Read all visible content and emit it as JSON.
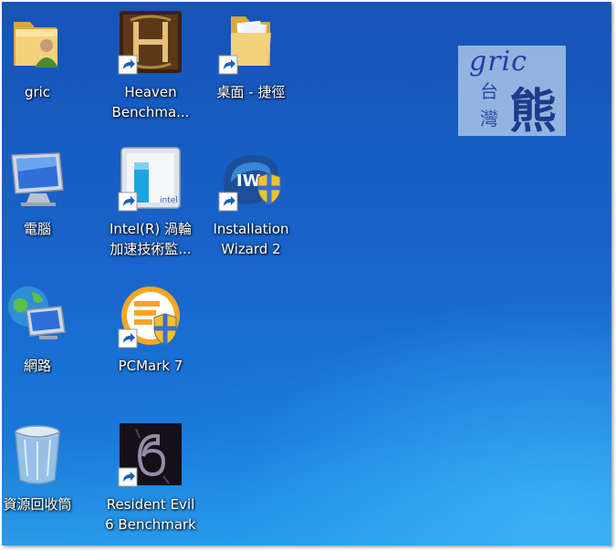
{
  "desktop_icons": [
    {
      "id": "gric",
      "label": "gric",
      "icon": "user-folder-icon"
    },
    {
      "id": "heaven",
      "label": "Heaven\nBenchma...",
      "icon": "heaven-benchmark-icon"
    },
    {
      "id": "desktop-shortcut",
      "label": "桌面 - 捷徑",
      "icon": "folder-icon"
    },
    {
      "id": "computer",
      "label": "電腦",
      "icon": "computer-icon"
    },
    {
      "id": "intel",
      "label": "Intel(R) 渦輪\n加速技術監...",
      "icon": "intel-turbo-icon"
    },
    {
      "id": "installation",
      "label": "Installation\nWizard 2",
      "icon": "installation-wizard-icon"
    },
    {
      "id": "network",
      "label": "網路",
      "icon": "network-icon"
    },
    {
      "id": "pcmark",
      "label": "PCMark 7",
      "icon": "pcmark-icon"
    },
    {
      "id": "recycle",
      "label": "資源回收筒",
      "icon": "recycle-bin-icon"
    },
    {
      "id": "resident",
      "label": "Resident Evil\n6 Benchmark",
      "icon": "resident-evil-icon"
    }
  ],
  "watermark": {
    "line1": "gric",
    "char_tai": "台",
    "char_wan": "灣",
    "char_xiong": "熊"
  },
  "colors": {
    "desktop_top": "#1653b9",
    "desktop_bottom": "#2a9be8",
    "label_text": "#ffffff"
  }
}
